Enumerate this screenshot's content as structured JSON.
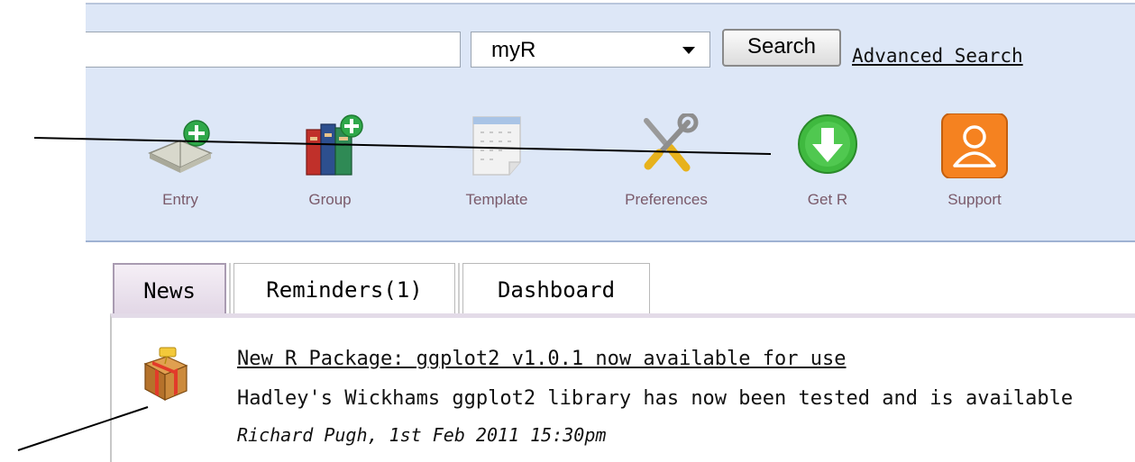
{
  "search": {
    "query": "",
    "scope_value": "myR",
    "button_label": "Search",
    "advanced_link": "Advanced Search"
  },
  "toolbar": {
    "items": [
      {
        "label": "Entry",
        "icon": "book-add-icon"
      },
      {
        "label": "Group",
        "icon": "books-add-icon"
      },
      {
        "label": "Template",
        "icon": "template-icon"
      },
      {
        "label": "Preferences",
        "icon": "tools-icon"
      },
      {
        "label": "Get R",
        "icon": "download-arrow-icon"
      },
      {
        "label": "Support",
        "icon": "support-person-icon"
      }
    ]
  },
  "tabs": [
    {
      "label": "News",
      "active": true
    },
    {
      "label": "Reminders(1)",
      "active": false
    },
    {
      "label": "Dashboard",
      "active": false
    }
  ],
  "news": {
    "icon": "package-icon",
    "title": "New R Package: ggplot2 v1.0.1 now available for use",
    "body": "Hadley's Wickhams ggplot2 library has now been tested and is available",
    "byline": "Richard Pugh, 1st Feb 2011 15:30pm"
  },
  "colors": {
    "header_bg": "#dde7f7",
    "tab_active_bg": "#e2d7e6",
    "label_text": "#7a5a6a",
    "support_orange": "#f58220",
    "get_r_green": "#3fb93f"
  }
}
